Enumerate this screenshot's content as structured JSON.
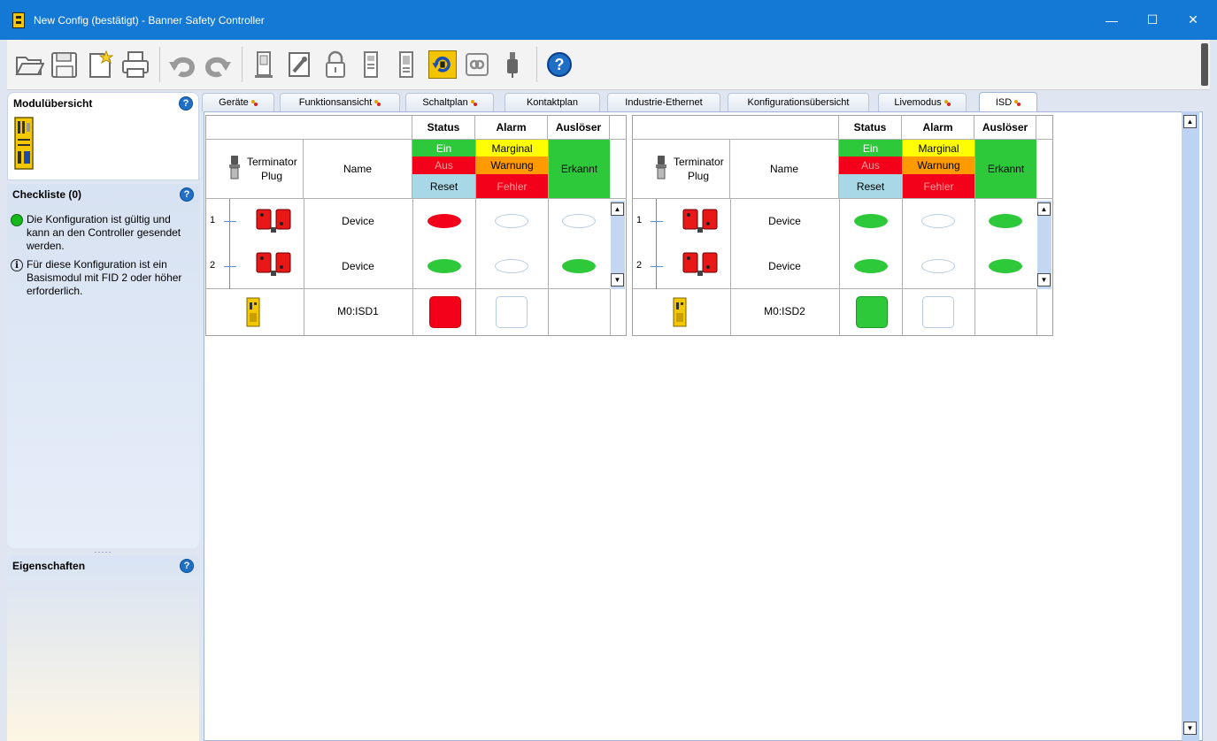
{
  "window": {
    "title": "New Config (bestätigt) - Banner Safety Controller",
    "minimize": "—",
    "maximize": "☐",
    "close": "✕"
  },
  "toolbar": {
    "buttons": [
      "open-folder-icon",
      "save-icon",
      "new-icon",
      "print-icon",
      "undo-icon",
      "redo-icon",
      "controller-icon",
      "edit-icon",
      "lock-icon",
      "module-icon",
      "module-2-icon",
      "refresh-icon",
      "link-icon",
      "plug-icon",
      "help-icon"
    ],
    "help_label": "?"
  },
  "left": {
    "module_overview": "Modulübersicht",
    "checklist": "Checkliste (0)",
    "checklist_items": [
      {
        "icon": "green-dot",
        "text": "Die Konfiguration ist gültig und kann an den Controller gesendet werden."
      },
      {
        "icon": "info-icon",
        "text": "Für diese Konfiguration ist ein Basismodul mit FID 2 oder höher erforderlich."
      }
    ],
    "info_glyph": "i",
    "splitter": "·····",
    "properties": "Eigenschaften",
    "help": "?"
  },
  "tabs": [
    {
      "label": "Geräte",
      "mark": true
    },
    {
      "label": "Funktionsansicht",
      "mark": true
    },
    {
      "label": "Schaltplan",
      "mark": true
    },
    {
      "label": "Kontaktplan",
      "mark": false
    },
    {
      "label": "Industrie-Ethernet",
      "mark": false
    },
    {
      "label": "Konfigurationsübersicht",
      "mark": false
    },
    {
      "label": "Livemodus",
      "mark": true
    },
    {
      "label": "ISD",
      "mark": true,
      "active": true
    }
  ],
  "isd_header": {
    "status": "Status",
    "alarm": "Alarm",
    "trigger": "Auslöser",
    "terminator": "Terminator",
    "plug": "Plug",
    "name": "Name",
    "status_legend": [
      "Ein",
      "Aus",
      "Reset"
    ],
    "alarm_legend": [
      "Marginal",
      "Warnung",
      "Fehler"
    ],
    "trigger_legend": "Erkannt"
  },
  "colors": {
    "green": "#2ec83b",
    "red": "#f3001a",
    "yellow": "#ffff00",
    "orange": "#ff9a00",
    "reset_blue": "#a8d8e6"
  },
  "isd_tables": [
    {
      "module": "M0:ISD1",
      "module_status": "red",
      "module_alarm": "empty",
      "devices": [
        {
          "num": "1",
          "name": "Device",
          "status": "red",
          "alarm": "empty",
          "trigger": "empty"
        },
        {
          "num": "2",
          "name": "Device",
          "status": "green",
          "alarm": "empty",
          "trigger": "green"
        }
      ]
    },
    {
      "module": "M0:ISD2",
      "module_status": "green",
      "module_alarm": "empty",
      "devices": [
        {
          "num": "1",
          "name": "Device",
          "status": "green",
          "alarm": "empty",
          "trigger": "green"
        },
        {
          "num": "2",
          "name": "Device",
          "status": "green",
          "alarm": "empty",
          "trigger": "green"
        }
      ]
    }
  ]
}
